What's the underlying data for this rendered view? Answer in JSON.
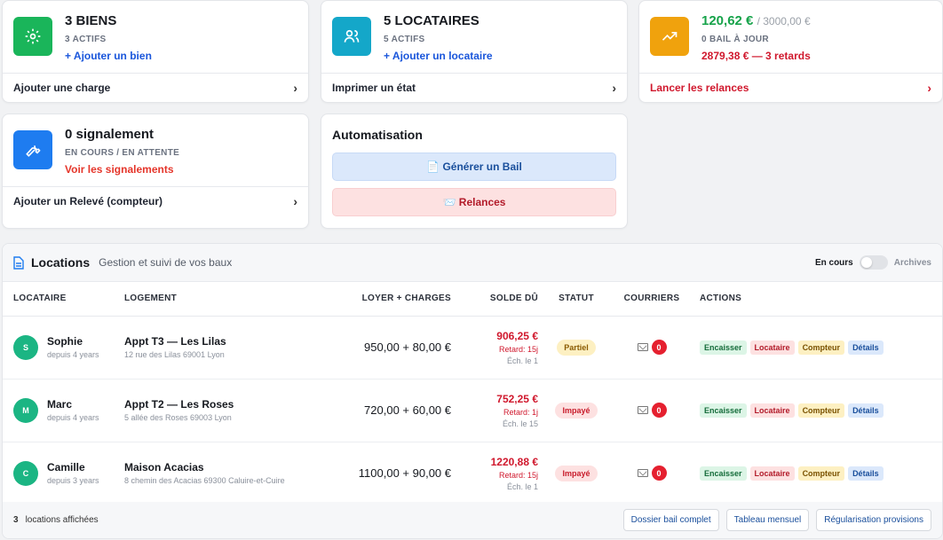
{
  "colors": {
    "green_tile": "#1ab55a",
    "teal_tile": "#14a7c9",
    "orange_tile": "#f0a20d",
    "blue_tile": "#1e7cf0",
    "positive": "#16a34a",
    "danger": "#d0182d",
    "link": "#1a56db"
  },
  "stats": {
    "biens": {
      "icon": "gear-icon",
      "main": "3 BIENS",
      "sub": "3 ACTIFS",
      "link": "+ Ajouter un bien",
      "footer": "Ajouter une charge"
    },
    "locataires": {
      "icon": "users-icon",
      "main": "5 LOCATAIRES",
      "sub": "5 ACTIFS",
      "link": "+ Ajouter un locataire",
      "footer": "Imprimer un état"
    },
    "finances": {
      "icon": "trend-up-icon",
      "amount": "120,62 €",
      "total": "/ 3000,00 €",
      "sub": "0 BAIL À JOUR",
      "late": "2879,38 € — 3 retards",
      "footer": "Lancer les relances"
    },
    "signalements": {
      "icon": "wrench-icon",
      "main": "0 signalement",
      "sub": "EN COURS / EN ATTENTE",
      "link": "Voir les signalements",
      "footer": "Ajouter un Relevé (compteur)"
    }
  },
  "automation": {
    "title": "Automatisation",
    "generate_label": "📄 Générer un Bail",
    "reminders_label": "📨 Relances"
  },
  "locations": {
    "title": "Locations",
    "subtitle": "Gestion et suivi de vos baux",
    "toggle_on": "En cours",
    "toggle_off": "Archives",
    "columns": [
      "LOCATAIRE",
      "LOGEMENT",
      "LOYER + CHARGES",
      "SOLDE DÛ",
      "STATUT",
      "COURRIERS",
      "ACTIONS"
    ],
    "rows": [
      {
        "initial": "S",
        "name": "Sophie",
        "since": "depuis 4 years",
        "lodging": "Appt T3 — Les Lilas",
        "address": "12 rue des Lilas 69001 Lyon",
        "rent": "950,00 + 80,00 €",
        "balance": "906,25 €",
        "delay": "Retard: 15j",
        "due": "Éch. le 1",
        "status": "Partiel",
        "letters": "0"
      },
      {
        "initial": "M",
        "name": "Marc",
        "since": "depuis 4 years",
        "lodging": "Appt T2 — Les Roses",
        "address": "5 allée des Roses 69003 Lyon",
        "rent": "720,00 + 60,00 €",
        "balance": "752,25 €",
        "delay": "Retard: 1j",
        "due": "Éch. le 15",
        "status": "Impayé",
        "letters": "0"
      },
      {
        "initial": "C",
        "name": "Camille",
        "since": "depuis 3 years",
        "lodging": "Maison Acacias",
        "address": "8 chemin des Acacias 69300 Caluire-et-Cuire",
        "rent": "1100,00 + 90,00 €",
        "balance": "1220,88 €",
        "delay": "Retard: 15j",
        "due": "Éch. le 1",
        "status": "Impayé",
        "letters": "0"
      }
    ],
    "actions": {
      "encaisser": "Encaisser",
      "locataire": "Locataire",
      "compteur": "Compteur",
      "details": "Détails"
    },
    "footer": {
      "count": "3",
      "count_label": "locations affichées",
      "btn_dossier": "Dossier bail complet",
      "btn_tableau": "Tableau mensuel",
      "btn_regul": "Régularisation provisions"
    }
  }
}
